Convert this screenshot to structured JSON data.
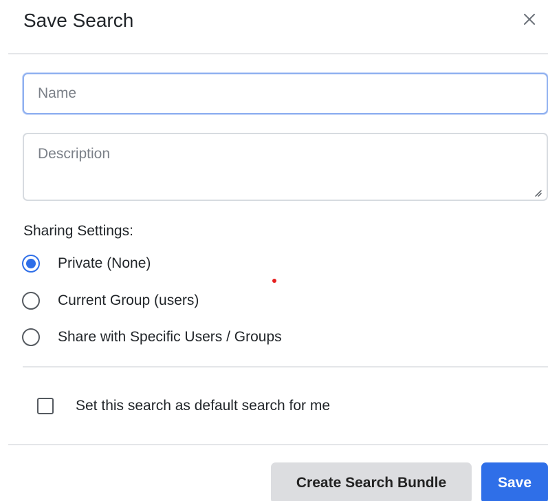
{
  "dialog": {
    "title": "Save Search",
    "close_icon": "close-icon"
  },
  "form": {
    "name_placeholder": "Name",
    "name_value": "",
    "description_placeholder": "Description",
    "description_value": ""
  },
  "sharing": {
    "label": "Sharing Settings:",
    "options": [
      {
        "label": "Private (None)",
        "checked": true
      },
      {
        "label": "Current Group (users)",
        "checked": false
      },
      {
        "label": "Share with Specific Users / Groups",
        "checked": false
      }
    ]
  },
  "default_search": {
    "label": "Set this search as default search for me",
    "checked": false
  },
  "footer": {
    "bundle_label": "Create Search Bundle",
    "save_label": "Save"
  },
  "colors": {
    "primary": "#2f6fe8",
    "secondary": "#dcdde0",
    "marker_dot": "#e62020"
  }
}
